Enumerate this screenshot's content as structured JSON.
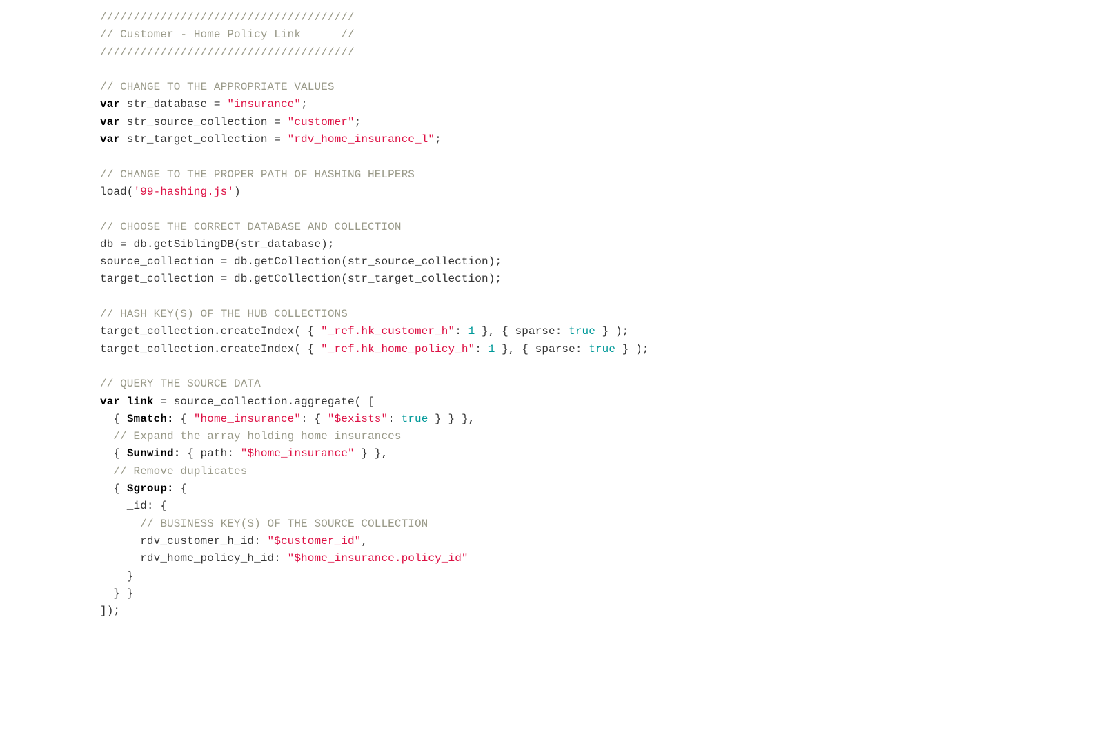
{
  "code": {
    "t01": "//////////////////////////////////////",
    "t02a": "// Customer - Home Policy Link      //",
    "t03": "//////////////////////////////////////",
    "t05": "// CHANGE TO THE APPROPRIATE VALUES",
    "t06k": "var",
    "t06a": " str_database = ",
    "t06s": "\"insurance\"",
    "t06e": ";",
    "t07k": "var",
    "t07a": " str_source_collection = ",
    "t07s": "\"customer\"",
    "t07e": ";",
    "t08k": "var",
    "t08a": " str_target_collection = ",
    "t08s": "\"rdv_home_insurance_l\"",
    "t08e": ";",
    "t10": "// CHANGE TO THE PROPER PATH OF HASHING HELPERS",
    "t11a": "load(",
    "t11s": "'99-hashing.js'",
    "t11e": ")",
    "t13": "// CHOOSE THE CORRECT DATABASE AND COLLECTION",
    "t14": "db = db.getSiblingDB(str_database);",
    "t15": "source_collection = db.getCollection(str_source_collection);",
    "t16": "target_collection = db.getCollection(str_target_collection);",
    "t18": "// HASH KEY(S) OF THE HUB COLLECTIONS",
    "t19a": "target_collection.createIndex( { ",
    "t19s": "\"_ref.hk_customer_h\"",
    "t19b": ": ",
    "t19n": "1",
    "t19c": " }, { sparse: ",
    "t19t": "true",
    "t19d": " } );",
    "t20a": "target_collection.createIndex( { ",
    "t20s": "\"_ref.hk_home_policy_h\"",
    "t20b": ": ",
    "t20n": "1",
    "t20c": " }, { sparse: ",
    "t20t": "true",
    "t20d": " } );",
    "t22": "// QUERY THE SOURCE DATA",
    "t23k": "var",
    "t23sp": " ",
    "t23k2": "link",
    "t23a": " = source_collection.aggregate( [",
    "t24a": "  { ",
    "t24k": "$match:",
    "t24b": " { ",
    "t24s1": "\"home_insurance\"",
    "t24c": ": { ",
    "t24s2": "\"$exists\"",
    "t24d": ": ",
    "t24t": "true",
    "t24e": " } } },",
    "t25": "  // Expand the array holding home insurances",
    "t26a": "  { ",
    "t26k": "$unwind:",
    "t26b": " { path: ",
    "t26s": "\"$home_insurance\"",
    "t26c": " } },",
    "t27": "  // Remove duplicates",
    "t28a": "  { ",
    "t28k": "$group:",
    "t28b": " {",
    "t29": "    _id: {",
    "t30": "      // BUSINESS KEY(S) OF THE SOURCE COLLECTION",
    "t31a": "      rdv_customer_h_id: ",
    "t31s": "\"$customer_id\"",
    "t31b": ",",
    "t32a": "      rdv_home_policy_h_id: ",
    "t32s": "\"$home_insurance.policy_id\"",
    "t33": "    }",
    "t34": "  } }",
    "t35": "]);"
  }
}
